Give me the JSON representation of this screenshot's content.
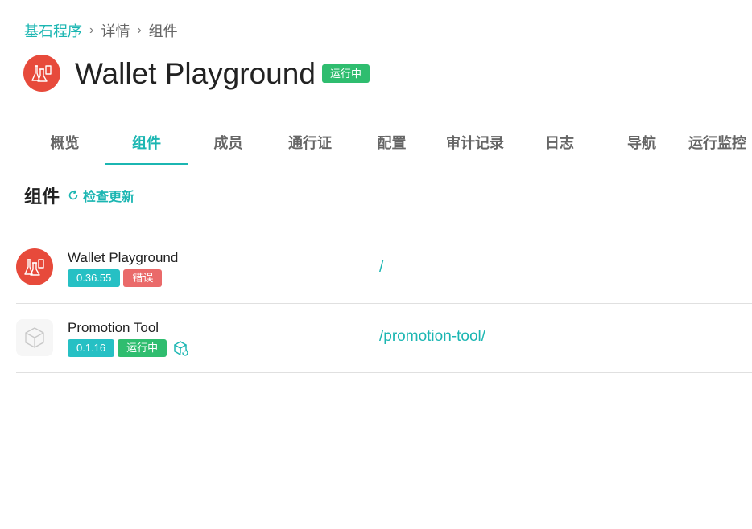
{
  "breadcrumb": {
    "root": "基石程序",
    "separator": "›",
    "detail": "详情",
    "current": "组件"
  },
  "header": {
    "title": "Wallet Playground",
    "status": "运行中"
  },
  "tabs": [
    {
      "label": "概览"
    },
    {
      "label": "组件",
      "active": true
    },
    {
      "label": "成员"
    },
    {
      "label": "通行证"
    },
    {
      "label": "配置"
    },
    {
      "label": "审计记录"
    },
    {
      "label": "日志"
    },
    {
      "label": "导航"
    },
    {
      "label": "运行监控"
    }
  ],
  "section": {
    "title": "组件",
    "check_update": "检查更新"
  },
  "components": [
    {
      "name": "Wallet Playground",
      "version": "0.36.55",
      "status": "错误",
      "path": "/"
    },
    {
      "name": "Promotion Tool",
      "version": "0.1.16",
      "status": "运行中",
      "path": "/promotion-tool/"
    }
  ],
  "colors": {
    "accent": "#1bb6b2",
    "running": "#2fbd6f",
    "error": "#ea6a6a",
    "version": "#26c0c4",
    "app_icon": "#e74a3b"
  },
  "icons": {
    "app": "flask-icon",
    "component_default": "cube-icon",
    "check_update": "refresh-icon",
    "upgrade": "cube-upgrade-icon"
  }
}
